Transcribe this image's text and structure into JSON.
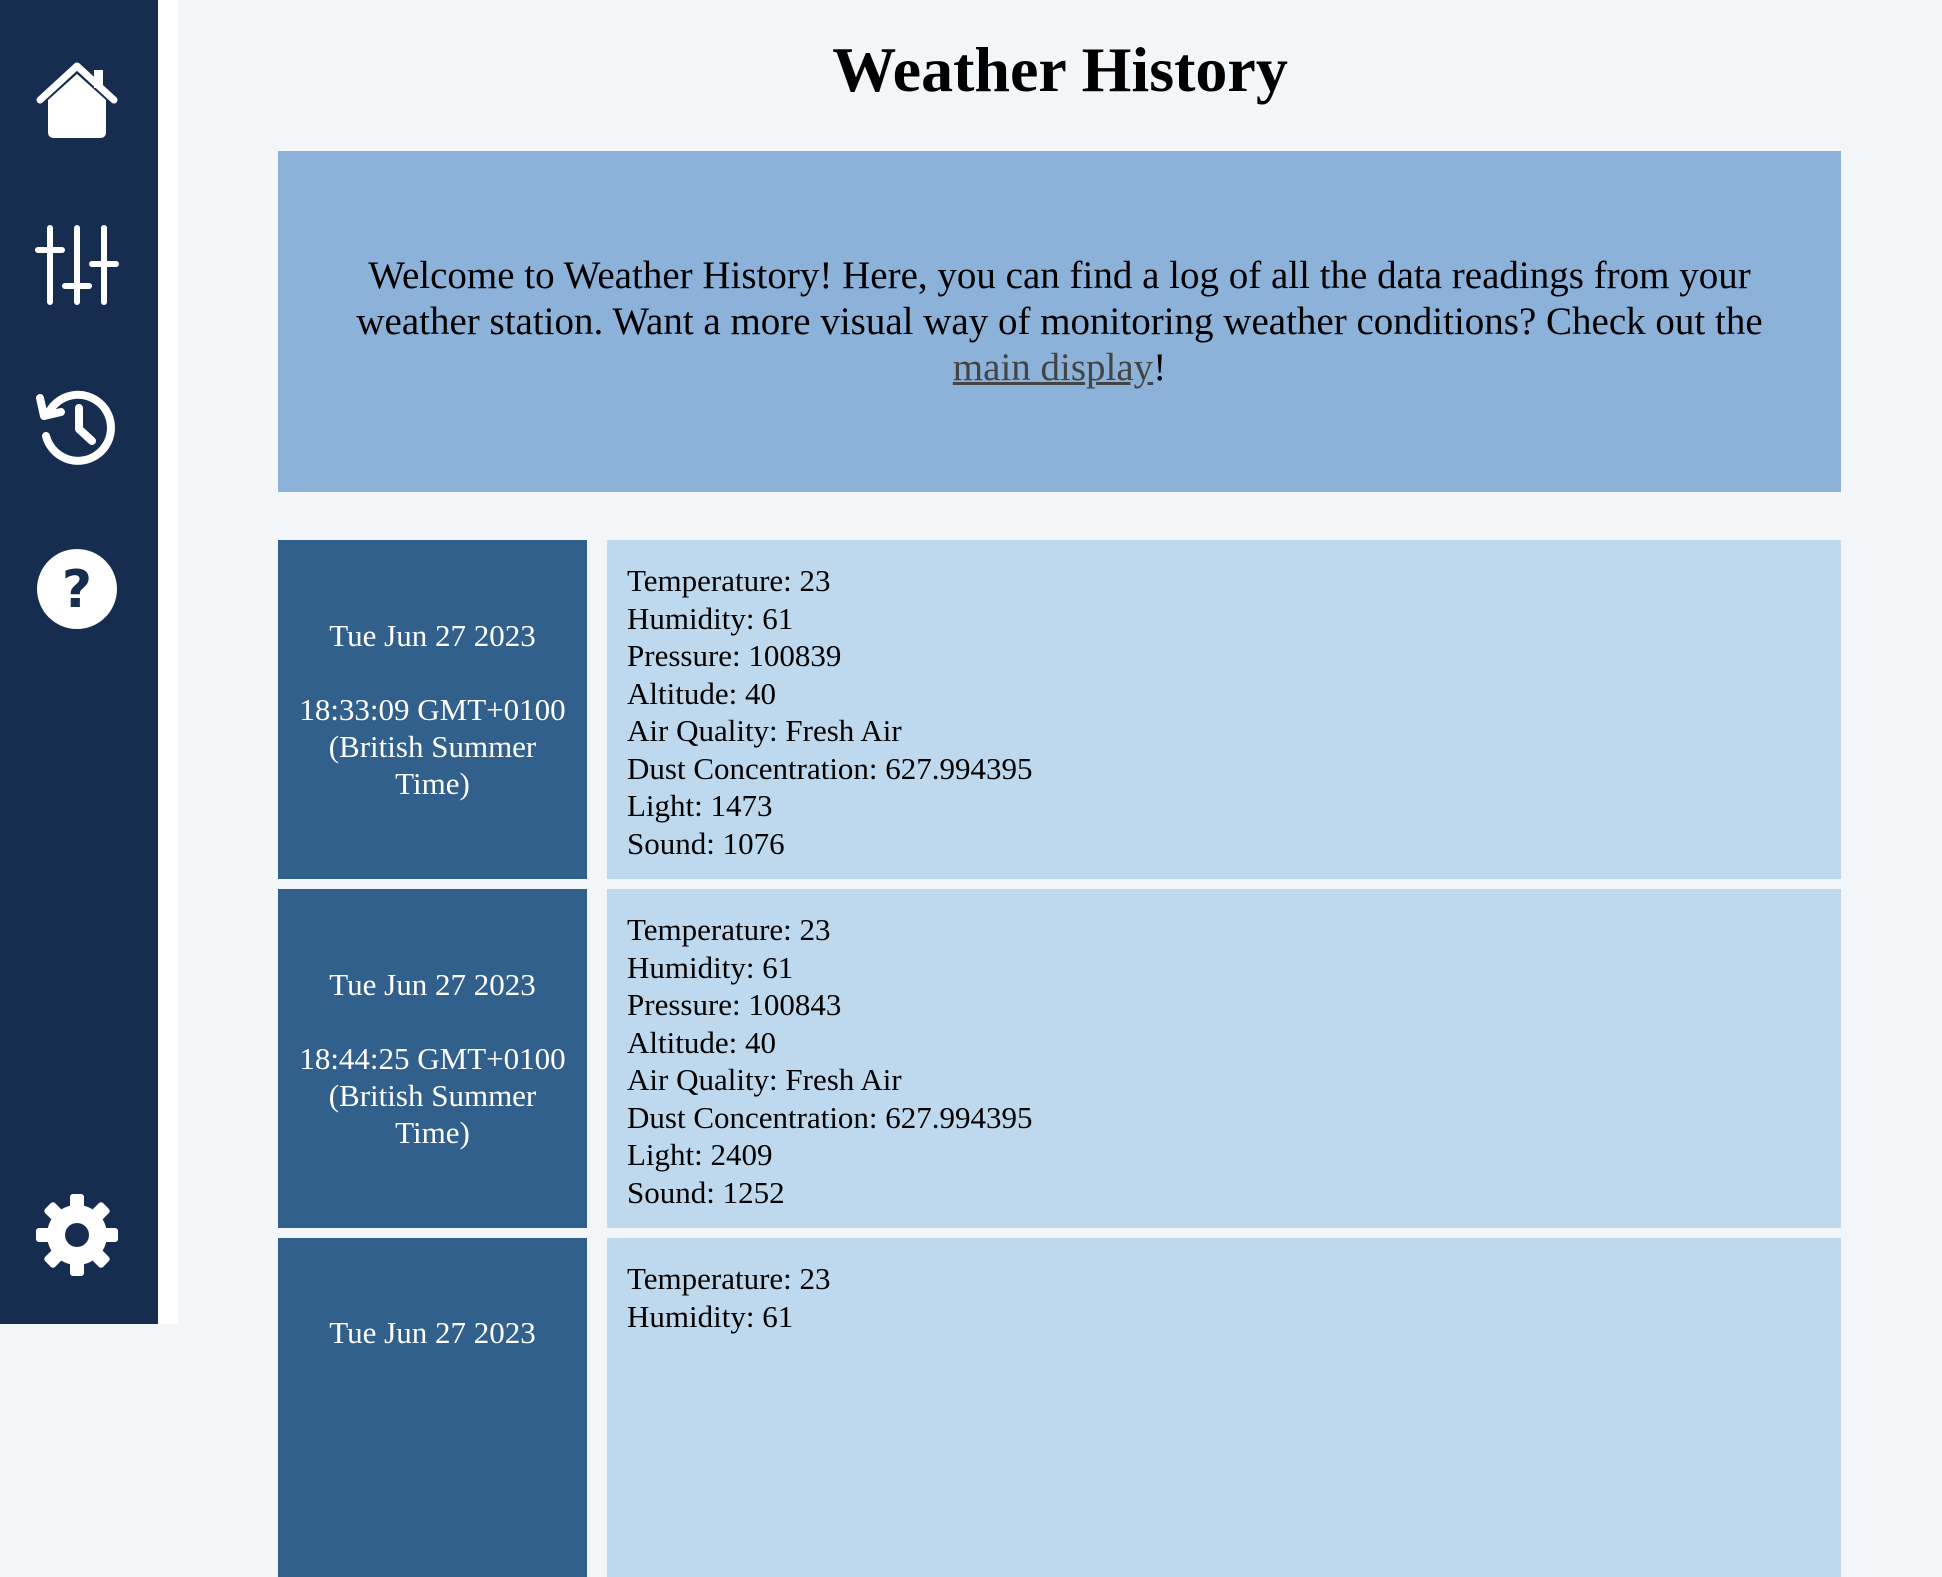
{
  "sidebar": {
    "items": [
      {
        "icon": "home-icon"
      },
      {
        "icon": "sliders-icon"
      },
      {
        "icon": "history-icon"
      },
      {
        "icon": "help-icon"
      },
      {
        "icon": "gear-icon"
      }
    ]
  },
  "page": {
    "title": "Weather History",
    "intro_before": "Welcome to Weather History! Here, you can find a log of all the data readings from your weather station. Want a more visual way of monitoring weather conditions? Check out the ",
    "intro_link": "main display",
    "intro_after": "!"
  },
  "records": [
    {
      "date": "Tue Jun 27 2023",
      "time": "18:33:09 GMT+0100 (British Summer Time)",
      "lines": [
        "Temperature: 23",
        "Humidity: 61",
        "Pressure: 100839",
        "Altitude: 40",
        "Air Quality: Fresh Air",
        "Dust Concentration: 627.994395",
        "Light: 1473",
        "Sound: 1076"
      ]
    },
    {
      "date": "Tue Jun 27 2023",
      "time": "18:44:25 GMT+0100 (British Summer Time)",
      "lines": [
        "Temperature: 23",
        "Humidity: 61",
        "Pressure: 100843",
        "Altitude: 40",
        "Air Quality: Fresh Air",
        "Dust Concentration: 627.994395",
        "Light: 2409",
        "Sound: 1252"
      ]
    },
    {
      "date": "Tue Jun 27 2023",
      "time": "",
      "lines": [
        "Temperature: 23",
        "Humidity: 61"
      ]
    }
  ],
  "colors": {
    "sidebar": "#172d4f",
    "intro_bg": "#8cb2d9",
    "date_bg": "#32608c",
    "data_bg": "#bed8ee"
  }
}
